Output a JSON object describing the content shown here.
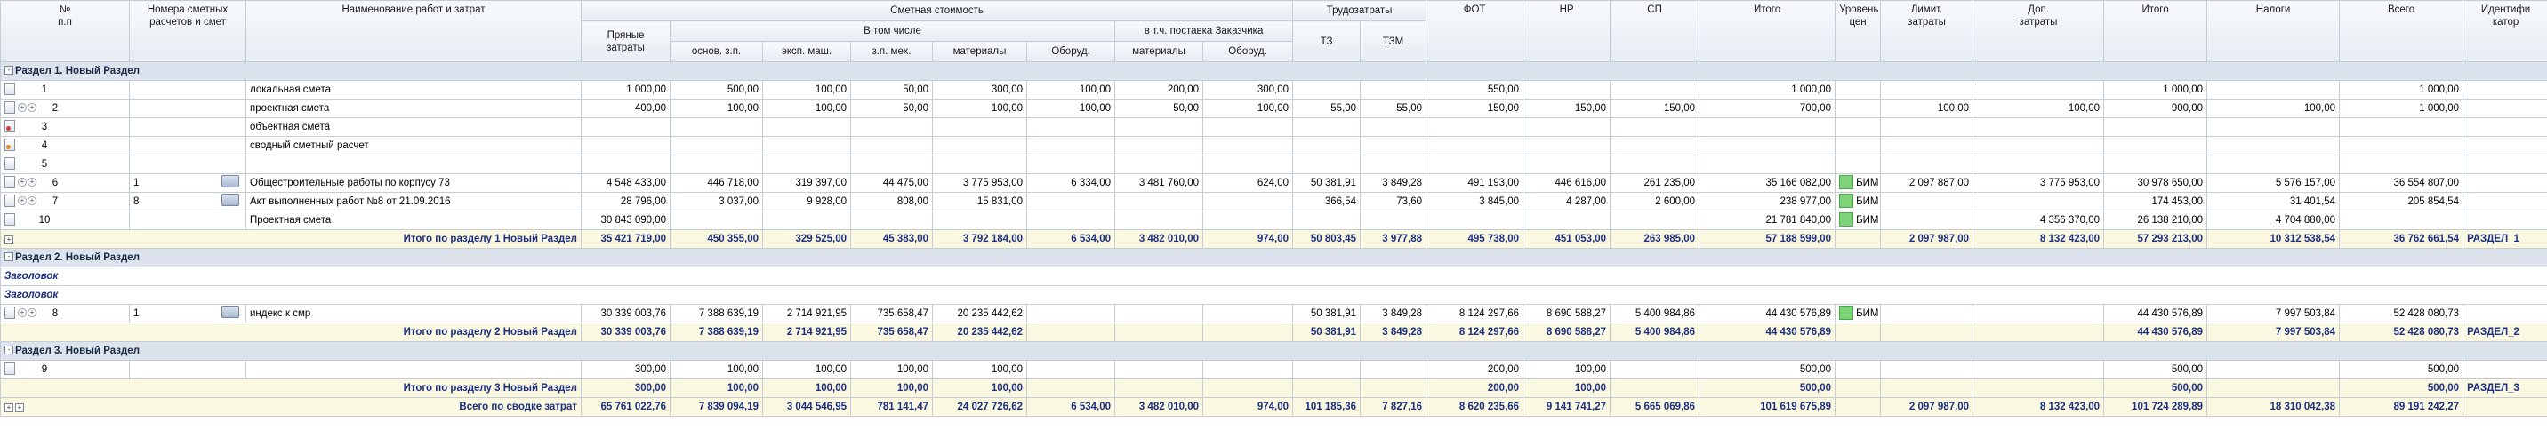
{
  "header": {
    "num": "№\nп.п",
    "calcnum": "Номера сметных\nрасчетов и смет",
    "name": "Наименование работ и затрат",
    "cost_group": "Сметная стоимость",
    "labor_group": "Трудозатраты",
    "fot": "ФОТ",
    "nr": "НР",
    "sp": "СП",
    "itogo": "Итого",
    "level": "Уровень\nцен",
    "limit": "Лимит.\nзатраты",
    "extra": "Доп.\nзатраты",
    "itogo2": "Итого",
    "taxes": "Налоги",
    "total": "Всего",
    "ident": "Идентифи\nкатор",
    "direct": "Пряные\nзатраты",
    "incl": "В том числе",
    "incl_customer": "в т.ч. поставка Заказчика",
    "osn": "основ. з.п.",
    "eksp": "эксп. маш.",
    "zpmeh": "з.п. мех.",
    "materials": "материалы",
    "equip": "Оборуд.",
    "materials2": "материалы",
    "equip2": "Оборуд.",
    "tz": "ТЗ",
    "tzm": "ТЗМ"
  },
  "sections": [
    {
      "title": "Раздел 1. Новый Раздел",
      "toggle": "-"
    },
    {
      "title": "Раздел 2. Новый Раздел",
      "toggle": "-"
    },
    {
      "title": "Раздел 3. Новый Раздел",
      "toggle": "-"
    }
  ],
  "headings": [
    "Заголовок",
    "Заголовок"
  ],
  "rows": [
    {
      "n": "1",
      "calc": "",
      "name": "локальная смета",
      "direct": "1 000,00",
      "osn": "500,00",
      "eksp": "100,00",
      "zpmeh": "50,00",
      "mat": "300,00",
      "equip": "100,00",
      "mat2": "200,00",
      "equip2": "300,00",
      "tz": "",
      "tzm": "",
      "fot": "550,00",
      "nr": "",
      "sp": "",
      "itogo": "1 000,00",
      "level": "",
      "limit": "",
      "extra": "",
      "itogo2": "1 000,00",
      "taxes": "",
      "total": "1 000,00",
      "ident": ""
    },
    {
      "n": "2",
      "calc": "",
      "name": "проектная смета",
      "direct": "400,00",
      "osn": "100,00",
      "eksp": "100,00",
      "zpmeh": "50,00",
      "mat": "100,00",
      "equip": "100,00",
      "mat2": "50,00",
      "equip2": "100,00",
      "tz": "55,00",
      "tzm": "55,00",
      "fot": "150,00",
      "nr": "150,00",
      "sp": "150,00",
      "itogo": "700,00",
      "level": "",
      "limit": "100,00",
      "extra": "100,00",
      "itogo2": "900,00",
      "taxes": "100,00",
      "total": "1 000,00",
      "ident": ""
    },
    {
      "n": "3",
      "calc": "",
      "name": "объектная смета",
      "direct": "",
      "osn": "",
      "eksp": "",
      "zpmeh": "",
      "mat": "",
      "equip": "",
      "mat2": "",
      "equip2": "",
      "tz": "",
      "tzm": "",
      "fot": "",
      "nr": "",
      "sp": "",
      "itogo": "",
      "level": "",
      "limit": "",
      "extra": "",
      "itogo2": "",
      "taxes": "",
      "total": "",
      "ident": ""
    },
    {
      "n": "4",
      "calc": "",
      "name": "сводный сметный расчет",
      "direct": "",
      "osn": "",
      "eksp": "",
      "zpmeh": "",
      "mat": "",
      "equip": "",
      "mat2": "",
      "equip2": "",
      "tz": "",
      "tzm": "",
      "fot": "",
      "nr": "",
      "sp": "",
      "itogo": "",
      "level": "",
      "limit": "",
      "extra": "",
      "itogo2": "",
      "taxes": "",
      "total": "",
      "ident": ""
    },
    {
      "n": "5",
      "calc": "",
      "name": "",
      "direct": "",
      "osn": "",
      "eksp": "",
      "zpmeh": "",
      "mat": "",
      "equip": "",
      "mat2": "",
      "equip2": "",
      "tz": "",
      "tzm": "",
      "fot": "",
      "nr": "",
      "sp": "",
      "itogo": "",
      "level": "",
      "limit": "",
      "extra": "",
      "itogo2": "",
      "taxes": "",
      "total": "",
      "ident": ""
    },
    {
      "n": "6",
      "calc": "1",
      "name": "Общестроительные работы по корпусу 73",
      "direct": "4 548 433,00",
      "osn": "446 718,00",
      "eksp": "319 397,00",
      "zpmeh": "44 475,00",
      "mat": "3 775 953,00",
      "equip": "6 334,00",
      "mat2": "3 481 760,00",
      "equip2": "624,00",
      "tz": "50 381,91",
      "tzm": "3 849,28",
      "fot": "491 193,00",
      "nr": "446 616,00",
      "sp": "261 235,00",
      "itogo": "35 166 082,00",
      "level": "БИМ",
      "limit": "2 097 887,00",
      "extra": "3 775 953,00",
      "itogo2": "30 978 650,00",
      "taxes": "5 576 157,00",
      "total": "36 554 807,00",
      "ident": ""
    },
    {
      "n": "7",
      "calc": "8",
      "name": "Акт выполненных работ №8 от 21.09.2016",
      "direct": "28 796,00",
      "osn": "3 037,00",
      "eksp": "9 928,00",
      "zpmeh": "808,00",
      "mat": "15 831,00",
      "equip": "",
      "mat2": "",
      "equip2": "",
      "tz": "366,54",
      "tzm": "73,60",
      "fot": "3 845,00",
      "nr": "4 287,00",
      "sp": "2 600,00",
      "itogo": "238 977,00",
      "level": "БИМ",
      "limit": "",
      "extra": "",
      "itogo2": "174 453,00",
      "taxes": "31 401,54",
      "total": "205 854,54",
      "ident": ""
    },
    {
      "n": "10",
      "calc": "",
      "name": "Проектная смета",
      "direct": "30 843 090,00",
      "osn": "",
      "eksp": "",
      "zpmeh": "",
      "mat": "",
      "equip": "",
      "mat2": "",
      "equip2": "",
      "tz": "",
      "tzm": "",
      "fot": "",
      "nr": "",
      "sp": "",
      "itogo": "21 781 840,00",
      "level": "БИМ",
      "limit": "",
      "extra": "4 356 370,00",
      "itogo2": "26 138 210,00",
      "taxes": "4 704 880,00",
      "total": "",
      "ident": ""
    },
    {
      "n": "8",
      "calc": "1",
      "name": "индекс к смр",
      "direct": "30 339 003,76",
      "osn": "7 388 639,19",
      "eksp": "2 714 921,95",
      "zpmeh": "735 658,47",
      "mat": "20 235 442,62",
      "equip": "",
      "mat2": "",
      "equip2": "",
      "tz": "50 381,91",
      "tzm": "3 849,28",
      "fot": "8 124 297,66",
      "nr": "8 690 588,27",
      "sp": "5 400 984,86",
      "itogo": "44 430 576,89",
      "level": "БИМ",
      "limit": "",
      "extra": "",
      "itogo2": "44 430 576,89",
      "taxes": "7 997 503,84",
      "total": "52 428 080,73",
      "ident": ""
    },
    {
      "n": "9",
      "calc": "",
      "name": "",
      "direct": "300,00",
      "osn": "100,00",
      "eksp": "100,00",
      "zpmeh": "100,00",
      "mat": "100,00",
      "equip": "",
      "mat2": "",
      "equip2": "",
      "tz": "",
      "tzm": "",
      "fot": "200,00",
      "nr": "100,00",
      "sp": "",
      "itogo": "500,00",
      "level": "",
      "limit": "",
      "extra": "",
      "itogo2": "500,00",
      "taxes": "",
      "total": "500,00",
      "ident": ""
    }
  ],
  "totals": [
    {
      "label": "Итого по разделу 1 Новый Раздел",
      "direct": "35 421 719,00",
      "osn": "450 355,00",
      "eksp": "329 525,00",
      "zpmeh": "45 383,00",
      "mat": "3 792 184,00",
      "equip": "6 534,00",
      "mat2": "3 482 010,00",
      "equip2": "974,00",
      "tz": "50 803,45",
      "tzm": "3 977,88",
      "fot": "495 738,00",
      "nr": "451 053,00",
      "sp": "263 985,00",
      "itogo": "57 188 599,00",
      "level": "",
      "limit": "2 097 987,00",
      "extra": "8 132 423,00",
      "itogo2": "57 293 213,00",
      "taxes": "10 312 538,54",
      "total": "36 762 661,54",
      "ident": "РАЗДЕЛ_1"
    },
    {
      "label": "Итого по разделу 2 Новый Раздел",
      "direct": "30 339 003,76",
      "osn": "7 388 639,19",
      "eksp": "2 714 921,95",
      "zpmeh": "735 658,47",
      "mat": "20 235 442,62",
      "equip": "",
      "mat2": "",
      "equip2": "",
      "tz": "50 381,91",
      "tzm": "3 849,28",
      "fot": "8 124 297,66",
      "nr": "8 690 588,27",
      "sp": "5 400 984,86",
      "itogo": "44 430 576,89",
      "level": "",
      "limit": "",
      "extra": "",
      "itogo2": "44 430 576,89",
      "taxes": "7 997 503,84",
      "total": "52 428 080,73",
      "ident": "РАЗДЕЛ_2"
    },
    {
      "label": "Итого по разделу 3 Новый Раздел",
      "direct": "300,00",
      "osn": "100,00",
      "eksp": "100,00",
      "zpmeh": "100,00",
      "mat": "100,00",
      "equip": "",
      "mat2": "",
      "equip2": "",
      "tz": "",
      "tzm": "",
      "fot": "200,00",
      "nr": "100,00",
      "sp": "",
      "itogo": "500,00",
      "level": "",
      "limit": "",
      "extra": "",
      "itogo2": "500,00",
      "taxes": "",
      "total": "500,00",
      "ident": "РАЗДЕЛ_3"
    },
    {
      "label": "Всего по сводке затрат",
      "direct": "65 761 022,76",
      "osn": "7 839 094,19",
      "eksp": "3 044 546,95",
      "zpmeh": "781 141,47",
      "mat": "24 027 726,62",
      "equip": "6 534,00",
      "mat2": "3 482 010,00",
      "equip2": "974,00",
      "tz": "101 185,36",
      "tzm": "7 827,16",
      "fot": "8 620 235,66",
      "nr": "9 141 741,27",
      "sp": "5 665 069,86",
      "itogo": "101 619 675,89",
      "level": "",
      "limit": "2 097 987,00",
      "extra": "8 132 423,00",
      "itogo2": "101 724 289,89",
      "taxes": "18 310 042,38",
      "total": "89 191 242,27",
      "ident": ""
    }
  ]
}
